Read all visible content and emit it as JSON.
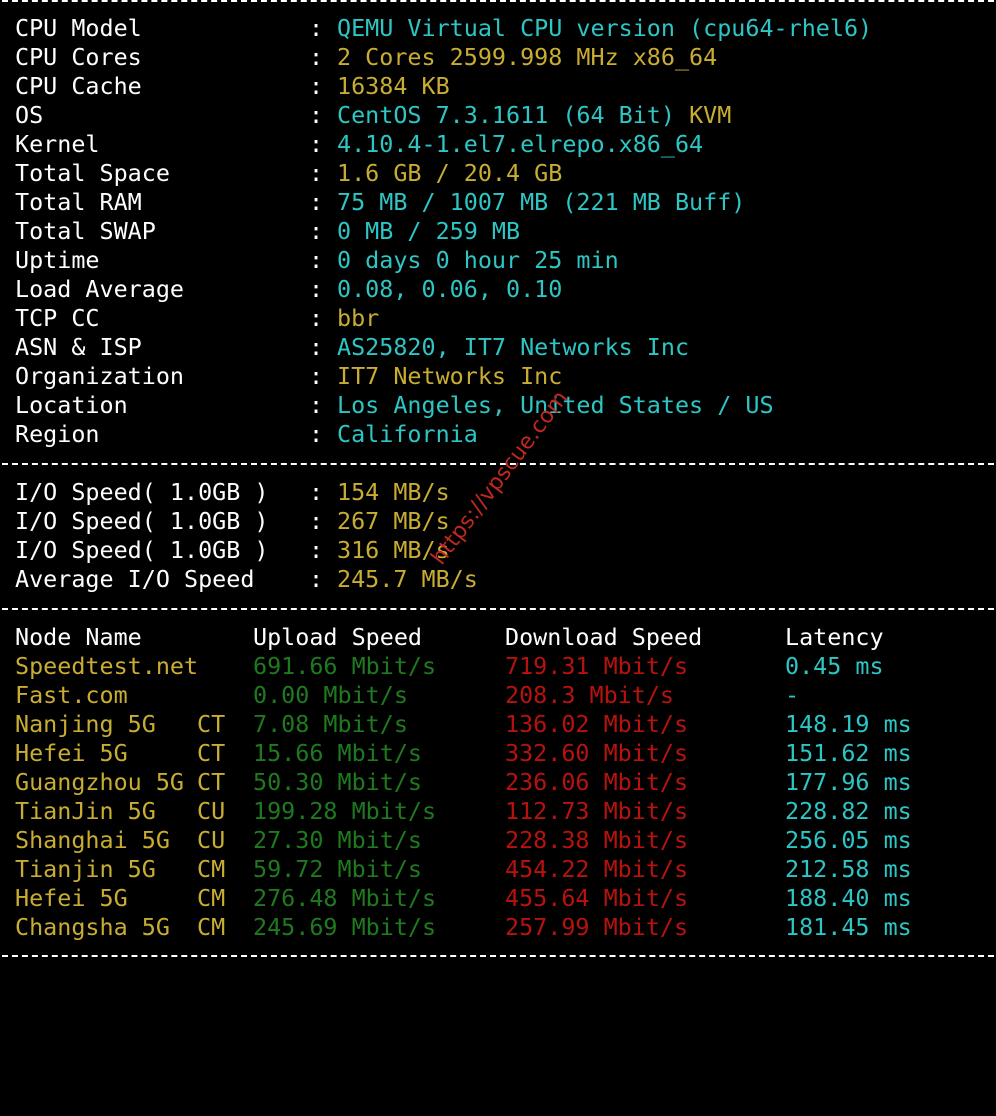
{
  "sysinfo": {
    "separator": ":",
    "rows": [
      {
        "label": "CPU Model",
        "value": "QEMU Virtual CPU version (cpu64-rhel6)"
      },
      {
        "label": "CPU Cores",
        "value": "2 Cores 2599.998 MHz x86_64"
      },
      {
        "label": "CPU Cache",
        "value": "16384 KB"
      },
      {
        "label": "OS",
        "value_a": "CentOS 7.3.1611 (64 Bit)",
        "value_b": "KVM"
      },
      {
        "label": "Kernel",
        "value": "4.10.4-1.el7.elrepo.x86_64"
      },
      {
        "label": "Total Space",
        "value": "1.6 GB / 20.4 GB"
      },
      {
        "label": "Total RAM",
        "value": "75 MB / 1007 MB (221 MB Buff)"
      },
      {
        "label": "Total SWAP",
        "value": "0 MB / 259 MB"
      },
      {
        "label": "Uptime",
        "value": "0 days 0 hour 25 min"
      },
      {
        "label": "Load Average",
        "value": "0.08, 0.06, 0.10"
      },
      {
        "label": "TCP CC",
        "value": "bbr"
      },
      {
        "label": "ASN & ISP",
        "value": "AS25820, IT7 Networks Inc"
      },
      {
        "label": "Organization",
        "value": "IT7 Networks Inc"
      },
      {
        "label": "Location",
        "value": "Los Angeles, United States / US"
      },
      {
        "label": "Region",
        "value": "California"
      }
    ]
  },
  "io": {
    "rows": [
      {
        "label": "I/O Speed( 1.0GB )",
        "value": "154 MB/s"
      },
      {
        "label": "I/O Speed( 1.0GB )",
        "value": "267 MB/s"
      },
      {
        "label": "I/O Speed( 1.0GB )",
        "value": "316 MB/s"
      },
      {
        "label": "Average I/O Speed",
        "value": "245.7 MB/s"
      }
    ]
  },
  "speedtest": {
    "headers": {
      "node": "Node Name",
      "upload": "Upload Speed",
      "download": "Download Speed",
      "latency": "Latency"
    },
    "rows": [
      {
        "node": "Speedtest.net",
        "isp": "",
        "upload": "691.66 Mbit/s",
        "download": "719.31 Mbit/s",
        "latency": "0.45 ms"
      },
      {
        "node": "Fast.com",
        "isp": "",
        "upload": "0.00 Mbit/s",
        "download": "208.3 Mbit/s",
        "latency": "-"
      },
      {
        "node": "Nanjing 5G",
        "isp": "CT",
        "upload": "7.08 Mbit/s",
        "download": "136.02 Mbit/s",
        "latency": "148.19 ms"
      },
      {
        "node": "Hefei 5G",
        "isp": "CT",
        "upload": "15.66 Mbit/s",
        "download": "332.60 Mbit/s",
        "latency": "151.62 ms"
      },
      {
        "node": "Guangzhou 5G",
        "isp": "CT",
        "upload": "50.30 Mbit/s",
        "download": "236.06 Mbit/s",
        "latency": "177.96 ms"
      },
      {
        "node": "TianJin 5G",
        "isp": "CU",
        "upload": "199.28 Mbit/s",
        "download": "112.73 Mbit/s",
        "latency": "228.82 ms"
      },
      {
        "node": "Shanghai 5G",
        "isp": "CU",
        "upload": "27.30 Mbit/s",
        "download": "228.38 Mbit/s",
        "latency": "256.05 ms"
      },
      {
        "node": "Tianjin 5G",
        "isp": "CM",
        "upload": "59.72 Mbit/s",
        "download": "454.22 Mbit/s",
        "latency": "212.58 ms"
      },
      {
        "node": "Hefei 5G",
        "isp": "CM",
        "upload": "276.48 Mbit/s",
        "download": "455.64 Mbit/s",
        "latency": "188.40 ms"
      },
      {
        "node": "Changsha 5G",
        "isp": "CM",
        "upload": "245.69 Mbit/s",
        "download": "257.99 Mbit/s",
        "latency": "181.45 ms"
      }
    ]
  },
  "watermark": "https://vpscue.com",
  "colors": {
    "background": "#000000",
    "label": "#ffffff",
    "cyan": "#2ec5c5",
    "yellow": "#c9ad32",
    "green": "#1f7a1f",
    "red": "#b7120e",
    "watermark": "#c0281f"
  }
}
